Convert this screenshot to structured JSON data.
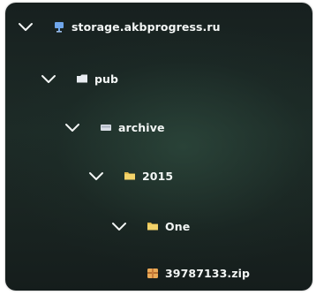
{
  "tree": {
    "root": {
      "label": "storage.akbprogress.ru",
      "icon": "server-icon",
      "expanded": true
    },
    "level1": {
      "label": "pub",
      "icon": "folder-icon",
      "expanded": true
    },
    "level2": {
      "label": "archive",
      "icon": "drive-icon",
      "expanded": true
    },
    "level3": {
      "label": "2015",
      "icon": "folder-icon",
      "expanded": true
    },
    "level4": {
      "label": "One",
      "icon": "folder-icon",
      "expanded": true
    },
    "file": {
      "label": "39787133.zip",
      "icon": "zip-archive-icon"
    }
  },
  "colors": {
    "text": "#f2f5f4",
    "folder_yellow": "#f3d36a",
    "folder_white": "#e8ecf1",
    "server_blue": "#6fa6ea",
    "zip_orange": "#e9a957"
  }
}
